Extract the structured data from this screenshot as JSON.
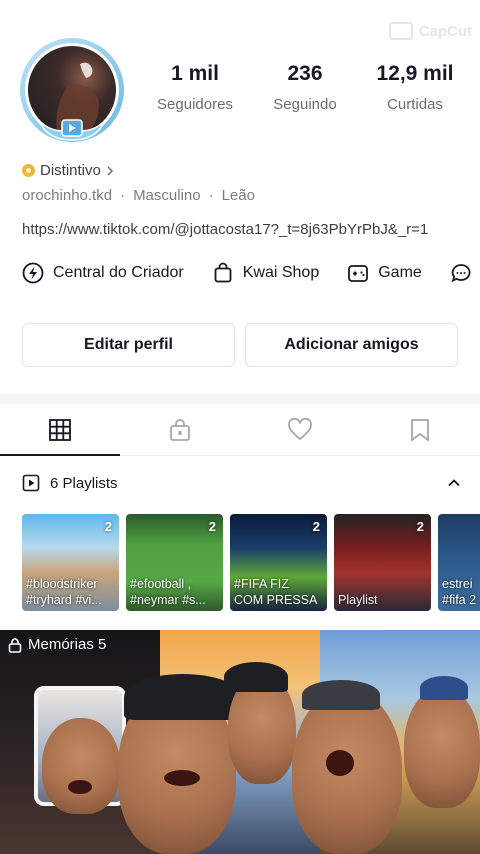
{
  "watermark": {
    "text": "CapCut"
  },
  "profile": {
    "stats": [
      {
        "value": "1 mil",
        "label": "Seguidores"
      },
      {
        "value": "236",
        "label": "Seguindo"
      },
      {
        "value": "12,9 mil",
        "label": "Curtidas"
      }
    ],
    "badge_label": "Distintivo",
    "username": "orochinho.tkd",
    "gender": "Masculino",
    "sign": "Leão",
    "link": "https://www.tiktok.com/@jottacosta17?_t=8j63PbYrPbJ&_r=1"
  },
  "shortcuts": [
    {
      "label": "Central do Criador",
      "icon": "lightning-circle-icon"
    },
    {
      "label": "Kwai Shop",
      "icon": "shopping-bag-icon"
    },
    {
      "label": "Game",
      "icon": "gamepad-icon"
    }
  ],
  "buttons": {
    "edit_profile": "Editar perfil",
    "add_friends": "Adicionar amigos"
  },
  "tabs": [
    "grid-icon",
    "lock-bag-icon",
    "heart-icon",
    "bookmark-icon"
  ],
  "playlists": {
    "title": "6 Playlists",
    "items": [
      {
        "count": "2",
        "tags": [
          "#bloodstriker",
          "#tryhard #vi..."
        ]
      },
      {
        "count": "2",
        "tags": [
          "#efootball ,",
          "#neymar #s..."
        ]
      },
      {
        "count": "2",
        "tags": [
          "#FIFA FIZ",
          "COM PRESSA"
        ]
      },
      {
        "count": "2",
        "tags": [
          "Playlist",
          ""
        ]
      },
      {
        "count": "",
        "tags": [
          "estrei",
          "#fifa 2"
        ]
      }
    ]
  },
  "memories": {
    "label": "Memórias 5"
  }
}
